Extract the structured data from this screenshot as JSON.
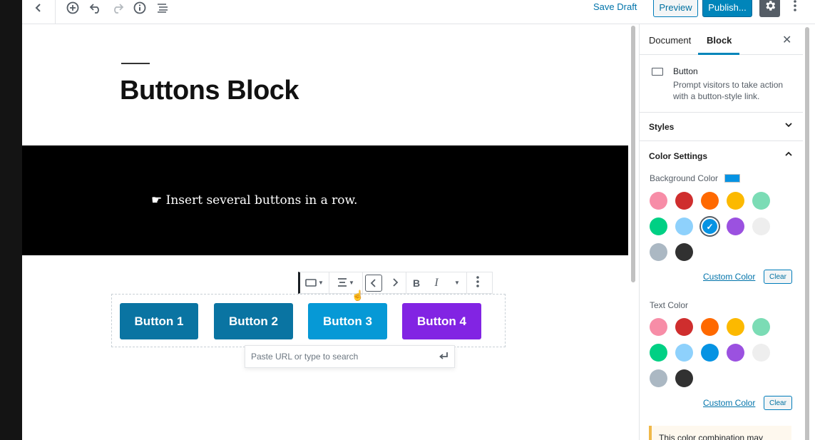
{
  "toolbar": {
    "back_icon": "chevron-left-icon",
    "add_block_icon": "plus-circle-icon",
    "undo_icon": "undo-icon",
    "redo_icon": "redo-icon",
    "info_icon": "info-icon",
    "outline_icon": "list-icon",
    "save_draft_label": "Save Draft",
    "preview_label": "Preview",
    "publish_label": "Publish...",
    "settings_icon": "gear-icon",
    "more_icon": "vertical-ellipsis-icon"
  },
  "editor": {
    "post_title": "Buttons Block",
    "cover_text": "☛ Insert several buttons in a row.",
    "block_toolbar": {
      "block_type_icon": "button-icon",
      "align_icon": "align-center-icon",
      "move_left_icon": "chevron-left-icon",
      "move_right_icon": "chevron-right-icon",
      "bold_label": "B",
      "italic_label": "I",
      "more_rich_text_icon": "caret-down-icon",
      "options_icon": "vertical-ellipsis-icon"
    },
    "buttons": [
      {
        "label": "Button 1",
        "color": "#0a74a2"
      },
      {
        "label": "Button 2",
        "color": "#0a74a2"
      },
      {
        "label": "Button 3",
        "color": "#0699d6"
      },
      {
        "label": "Button 4",
        "color": "#8224e3"
      }
    ],
    "url_placeholder": "Paste URL or type to search",
    "url_submit_icon": "enter-icon"
  },
  "sidebar": {
    "tabs": [
      {
        "label": "Document"
      },
      {
        "label": "Block"
      }
    ],
    "close_icon": "close-icon",
    "block_card": {
      "title": "Button",
      "description": "Prompt visitors to take action with a button-style link."
    },
    "styles_label": "Styles",
    "color_settings_label": "Color Settings",
    "background_color_label": "Background Color",
    "background_color_value": "#0693e3",
    "text_color_label": "Text Color",
    "palette": [
      "#f78da7",
      "#cf2e2e",
      "#ff6900",
      "#fcb900",
      "#7bdcb5",
      "#00d084",
      "#8ed1fc",
      "#0693e3",
      "#9b51e0",
      "#eeeeee",
      "#abb8c3",
      "#313131"
    ],
    "selected_background": "#0693e3",
    "custom_color_label": "Custom Color",
    "clear_label": "Clear",
    "notice_text": "This color combination may"
  }
}
